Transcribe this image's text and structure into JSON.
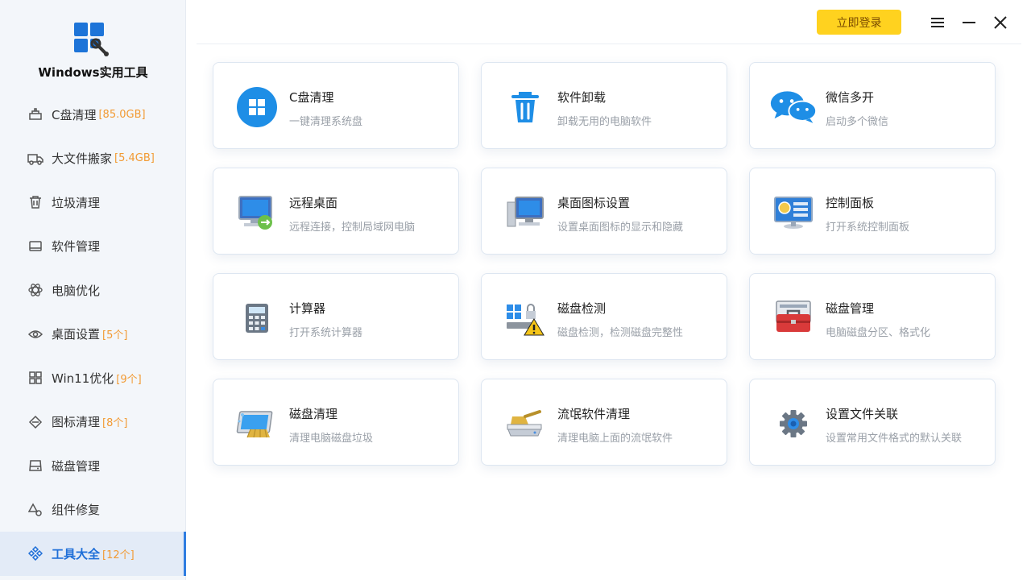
{
  "app": {
    "title": "Windows实用工具"
  },
  "topbar": {
    "login_label": "立即登录"
  },
  "sidebar": {
    "items": [
      {
        "label": "C盘清理",
        "count": "[85.0GB]",
        "icon": "broom-icon"
      },
      {
        "label": "大文件搬家",
        "count": "[5.4GB]",
        "icon": "truck-icon"
      },
      {
        "label": "垃圾清理",
        "count": "",
        "icon": "trash-icon"
      },
      {
        "label": "软件管理",
        "count": "",
        "icon": "monitor-icon"
      },
      {
        "label": "电脑优化",
        "count": "",
        "icon": "atom-icon"
      },
      {
        "label": "桌面设置",
        "count": "[5个]",
        "icon": "eye-icon"
      },
      {
        "label": "Win11优化",
        "count": "[9个]",
        "icon": "grid-icon"
      },
      {
        "label": "图标清理",
        "count": "[8个]",
        "icon": "diamond-icon"
      },
      {
        "label": "磁盘管理",
        "count": "",
        "icon": "disk-icon"
      },
      {
        "label": "组件修复",
        "count": "",
        "icon": "shapes-icon"
      },
      {
        "label": "工具大全",
        "count": "[12个]",
        "icon": "tools-icon"
      }
    ],
    "active_index": 10
  },
  "tools": [
    {
      "title": "C盘清理",
      "desc": "一键清理系统盘",
      "icon": "windows-logo-icon"
    },
    {
      "title": "软件卸载",
      "desc": "卸载无用的电脑软件",
      "icon": "trash-can-icon"
    },
    {
      "title": "微信多开",
      "desc": "启动多个微信",
      "icon": "wechat-icon"
    },
    {
      "title": "远程桌面",
      "desc": "远程连接，控制局域网电脑",
      "icon": "remote-desktop-icon"
    },
    {
      "title": "桌面图标设置",
      "desc": "设置桌面图标的显示和隐藏",
      "icon": "desktop-computer-icon"
    },
    {
      "title": "控制面板",
      "desc": "打开系统控制面板",
      "icon": "control-panel-icon"
    },
    {
      "title": "计算器",
      "desc": "打开系统计算器",
      "icon": "calculator-icon"
    },
    {
      "title": "磁盘检测",
      "desc": "磁盘检测，检测磁盘完整性",
      "icon": "disk-check-icon"
    },
    {
      "title": "磁盘管理",
      "desc": "电脑磁盘分区、格式化",
      "icon": "toolbox-icon"
    },
    {
      "title": "磁盘清理",
      "desc": "清理电脑磁盘垃圾",
      "icon": "disk-cleanup-icon"
    },
    {
      "title": "流氓软件清理",
      "desc": "清理电脑上面的流氓软件",
      "icon": "drive-broom-icon"
    },
    {
      "title": "设置文件关联",
      "desc": "设置常用文件格式的默认关联",
      "icon": "gear-icon"
    }
  ],
  "colors": {
    "accent": "#2f7de1",
    "login_button": "#ffd21f",
    "count_text": "#f29a33"
  }
}
